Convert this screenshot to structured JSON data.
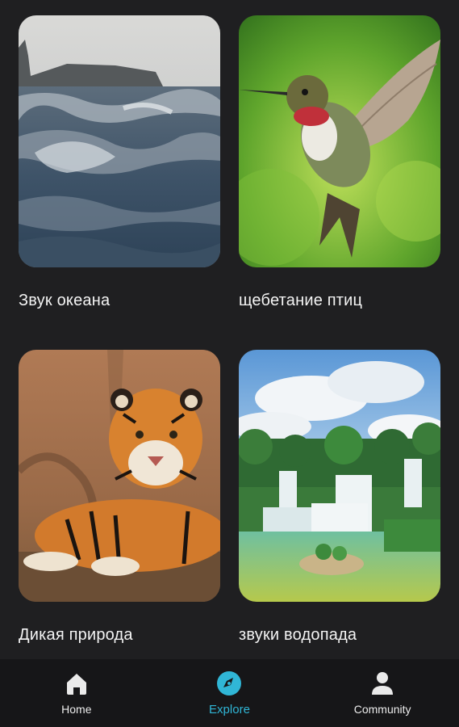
{
  "cards": [
    {
      "title": "Звук океана",
      "image": "ocean-waves-photo"
    },
    {
      "title": "щебетание птиц",
      "image": "hummingbird-photo"
    },
    {
      "title": "Дикая природа",
      "image": "tiger-photo"
    },
    {
      "title": "звуки водопада",
      "image": "waterfall-photo"
    }
  ],
  "nav": {
    "items": [
      {
        "label": "Home",
        "icon": "home-icon",
        "active": false
      },
      {
        "label": "Explore",
        "icon": "compass-icon",
        "active": true
      },
      {
        "label": "Community",
        "icon": "person-icon",
        "active": false
      }
    ],
    "active_color": "#30b6d6",
    "background": "#161618"
  },
  "background": "#1f1f21"
}
